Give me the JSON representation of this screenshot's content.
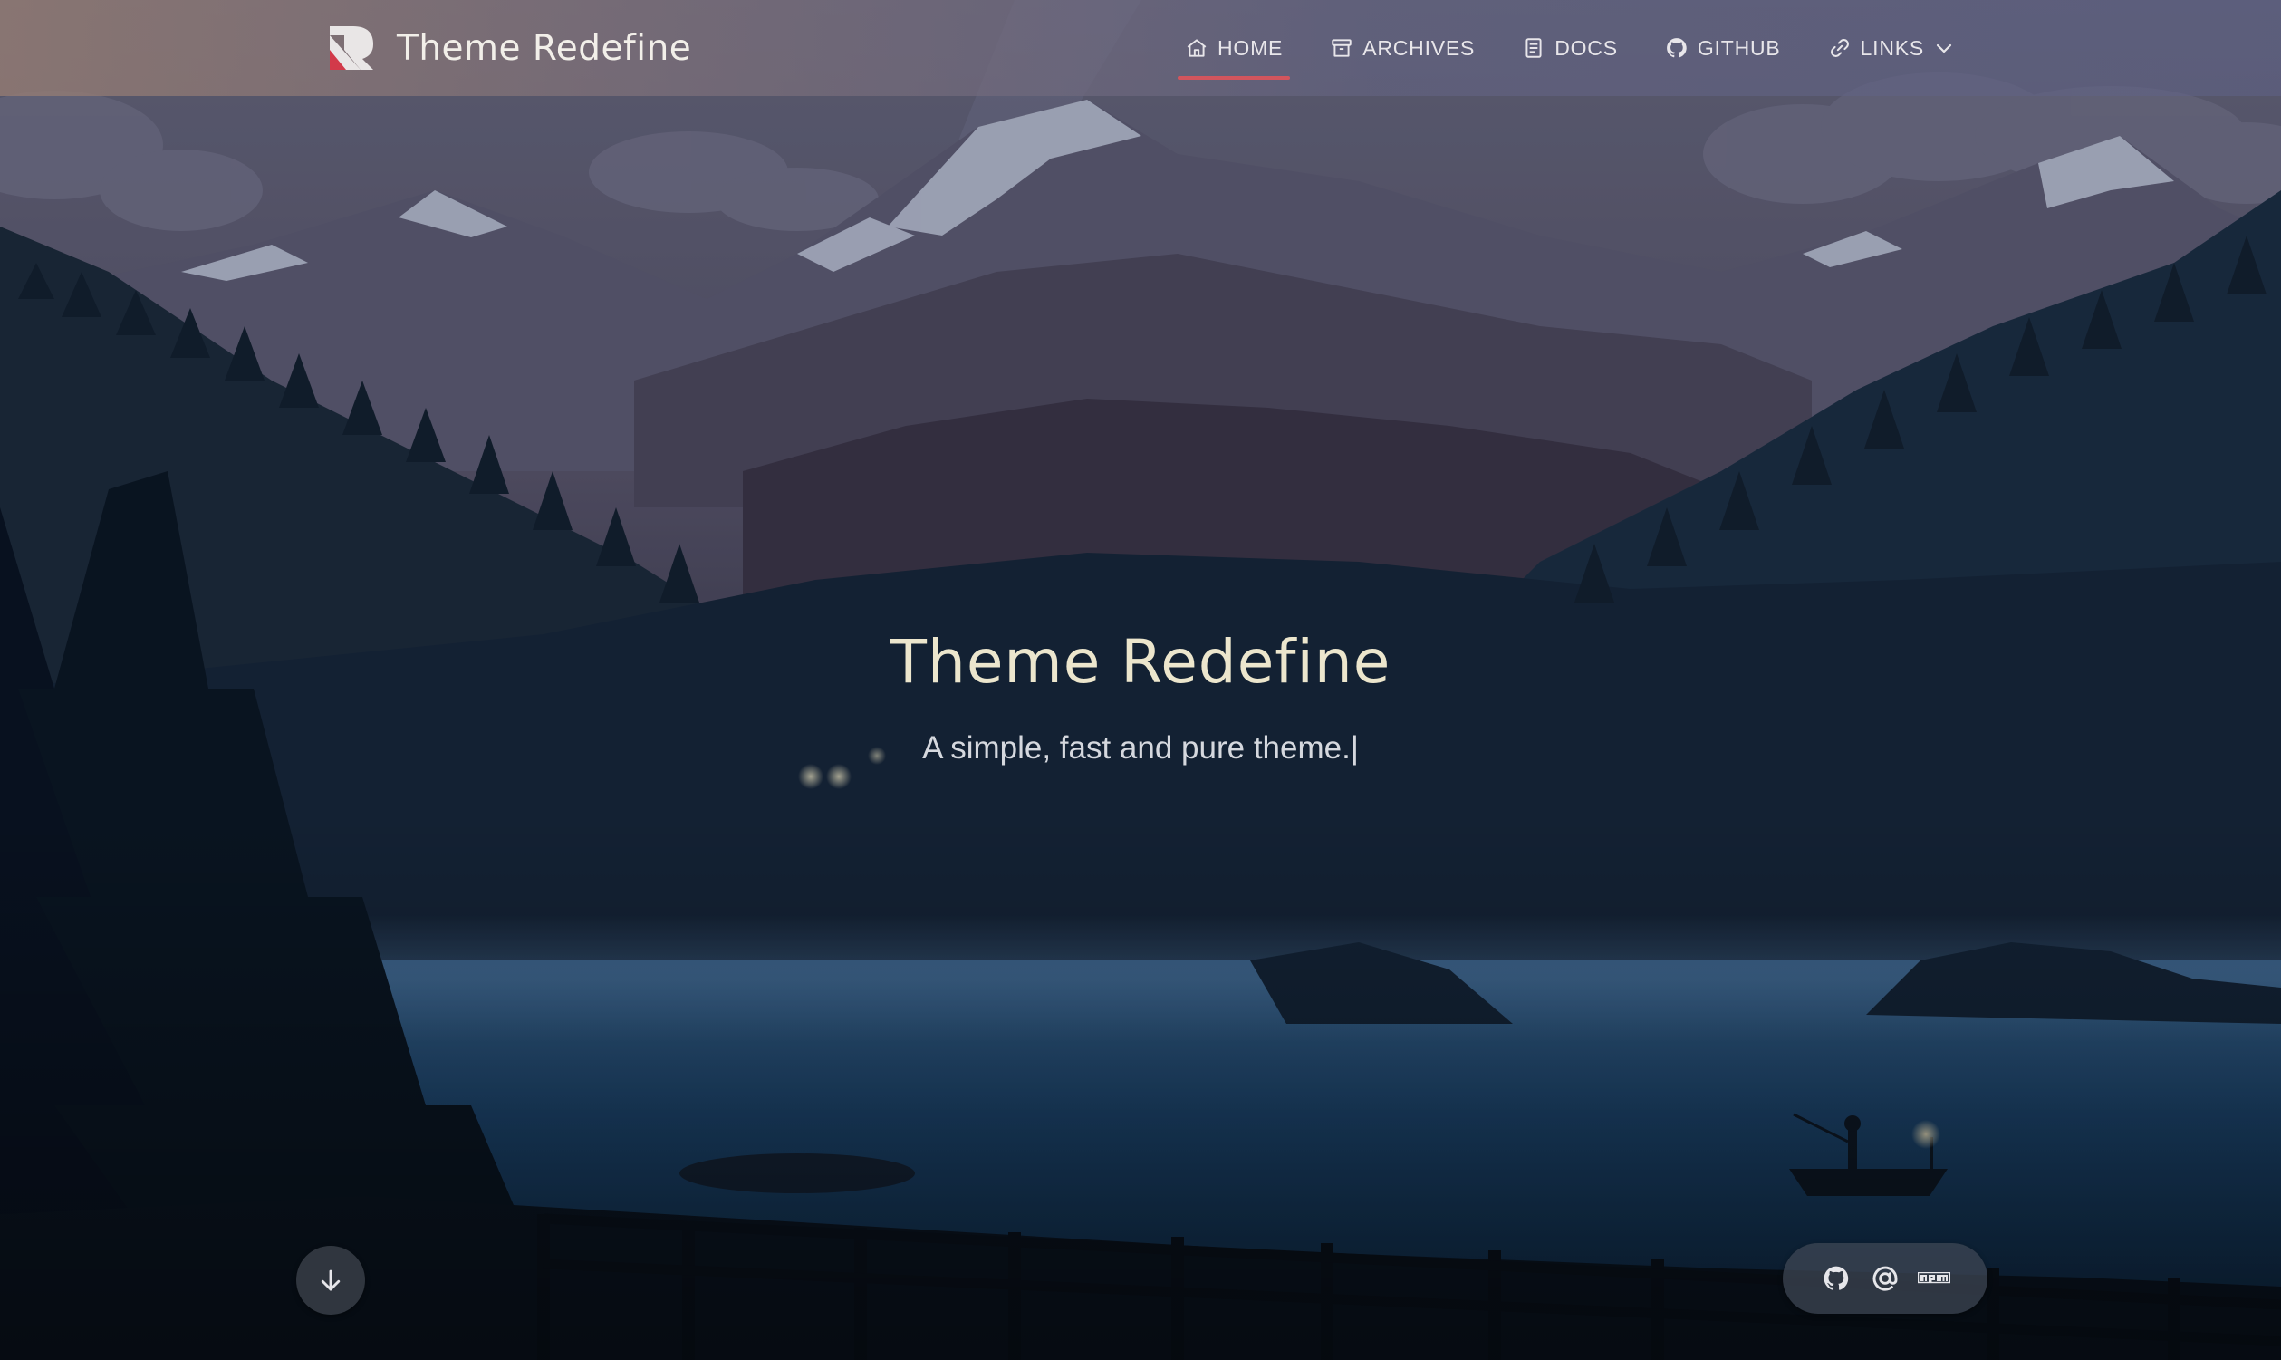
{
  "brand": {
    "title": "Theme Redefine",
    "logo_icon": "redefine-logo-icon"
  },
  "nav": {
    "items": [
      {
        "label": "HOME",
        "icon": "home-icon",
        "active": true
      },
      {
        "label": "ARCHIVES",
        "icon": "archive-icon",
        "active": false
      },
      {
        "label": "DOCS",
        "icon": "document-icon",
        "active": false
      },
      {
        "label": "GITHUB",
        "icon": "github-icon",
        "active": false
      },
      {
        "label": "LINKS",
        "icon": "link-icon",
        "active": false,
        "dropdown": true
      }
    ],
    "active_indicator_color": "#d2555d"
  },
  "hero": {
    "title": "Theme Redefine",
    "subtitle": "A simple, fast and pure theme.",
    "typing_cursor": "|"
  },
  "controls": {
    "scroll_down_icon": "arrow-down-icon",
    "social_links": [
      {
        "icon": "github-icon"
      },
      {
        "icon": "at-sign-icon"
      },
      {
        "icon": "npm-icon"
      }
    ]
  },
  "colors": {
    "title": "#ece6cd",
    "accent": "#d2555d",
    "nav_text": "#e8e6ea"
  }
}
